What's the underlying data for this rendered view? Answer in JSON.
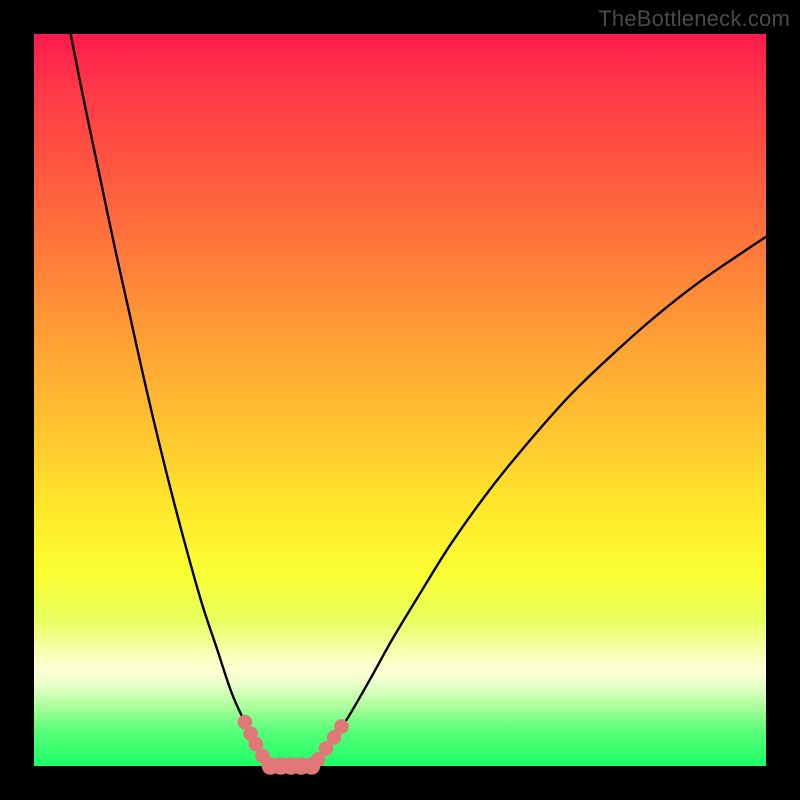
{
  "watermark": "TheBottleneck.com",
  "chart_data": {
    "type": "line",
    "title": "",
    "xlabel": "",
    "ylabel": "",
    "xlim": [
      0,
      100
    ],
    "ylim": [
      0,
      100
    ],
    "series": [
      {
        "name": "curve-left",
        "x": [
          5,
          7,
          9,
          11,
          13,
          15,
          17,
          19,
          21,
          23,
          25,
          27,
          28.8,
          30.2,
          31.2,
          32
        ],
        "y": [
          100,
          90,
          80.5,
          71,
          62,
          53,
          44.5,
          36.5,
          29,
          22,
          16,
          10,
          6,
          3.2,
          1.4,
          0
        ]
      },
      {
        "name": "curve-right",
        "x": [
          38,
          39.4,
          41,
          43,
          46,
          49,
          53,
          57,
          62,
          67,
          73,
          79,
          85,
          91,
          97,
          100
        ],
        "y": [
          0,
          1.7,
          3.8,
          6.8,
          12,
          17.4,
          24,
          30.4,
          37.4,
          43.6,
          50.4,
          56.2,
          61.5,
          66.2,
          70.3,
          72.3
        ]
      },
      {
        "name": "valley-floor",
        "x": [
          32,
          33.7,
          35,
          36.5,
          38
        ],
        "y": [
          0,
          0,
          0,
          0,
          0
        ]
      }
    ],
    "markers": {
      "left_wall": [
        {
          "x": 28.8,
          "y": 6.0
        },
        {
          "x": 29.6,
          "y": 4.4
        },
        {
          "x": 30.3,
          "y": 3.0
        },
        {
          "x": 31.2,
          "y": 1.4
        }
      ],
      "right_wall": [
        {
          "x": 38.8,
          "y": 0.9
        },
        {
          "x": 39.9,
          "y": 2.4
        },
        {
          "x": 41.0,
          "y": 3.9
        },
        {
          "x": 42.0,
          "y": 5.4
        }
      ],
      "floor": [
        {
          "x": 32.3,
          "y": 0
        },
        {
          "x": 33.7,
          "y": 0
        },
        {
          "x": 35.1,
          "y": 0
        },
        {
          "x": 36.5,
          "y": 0
        },
        {
          "x": 37.9,
          "y": 0
        }
      ],
      "radius_wall": 7.3,
      "radius_floor": 8.8,
      "color": "#e07878"
    }
  }
}
